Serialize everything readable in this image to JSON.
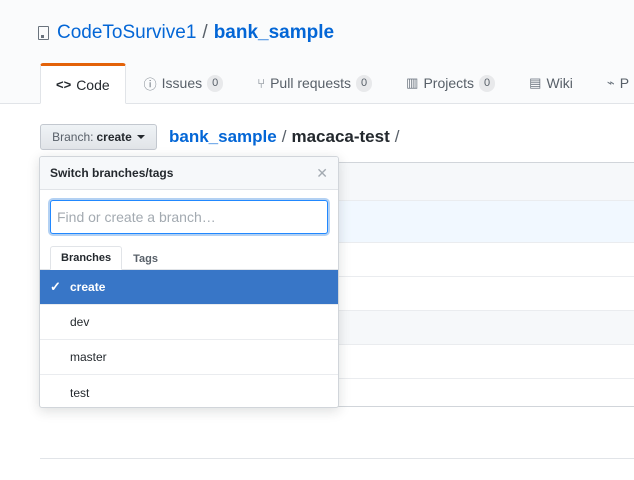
{
  "repo": {
    "owner": "CodeToSurvive1",
    "separator": "/",
    "name": "bank_sample"
  },
  "tabs": [
    {
      "icon": "code-icon",
      "label": "Code",
      "count": null
    },
    {
      "icon": "issue-opened-icon",
      "label": "Issues",
      "count": "0"
    },
    {
      "icon": "git-pull-request-icon",
      "label": "Pull requests",
      "count": "0"
    },
    {
      "icon": "project-icon",
      "label": "Projects",
      "count": "0"
    },
    {
      "icon": "book-icon",
      "label": "Wiki",
      "count": null
    },
    {
      "icon": "pulse-icon",
      "label": "P",
      "count": null
    }
  ],
  "branch_button": {
    "prefix": "Branch:",
    "value": "create"
  },
  "breadcrumb": {
    "repo": "bank_sample",
    "sep1": "/",
    "dir": "macaca-test",
    "sep2": "/"
  },
  "dropdown": {
    "title": "Switch branches/tags",
    "filter_placeholder": "Find or create a branch…",
    "filter_value": "",
    "tabs": [
      "Branches",
      "Tags"
    ],
    "selected_tab": "Branches",
    "items": [
      {
        "label": "create",
        "selected": true
      },
      {
        "label": "dev",
        "selected": false
      },
      {
        "label": "master",
        "selected": false
      },
      {
        "label": "test",
        "selected": false
      }
    ]
  },
  "colors": {
    "link": "#0366d6",
    "tab_accent": "#e36209",
    "selected_item_bg": "#3876c7",
    "focus_border": "#2188ff"
  }
}
